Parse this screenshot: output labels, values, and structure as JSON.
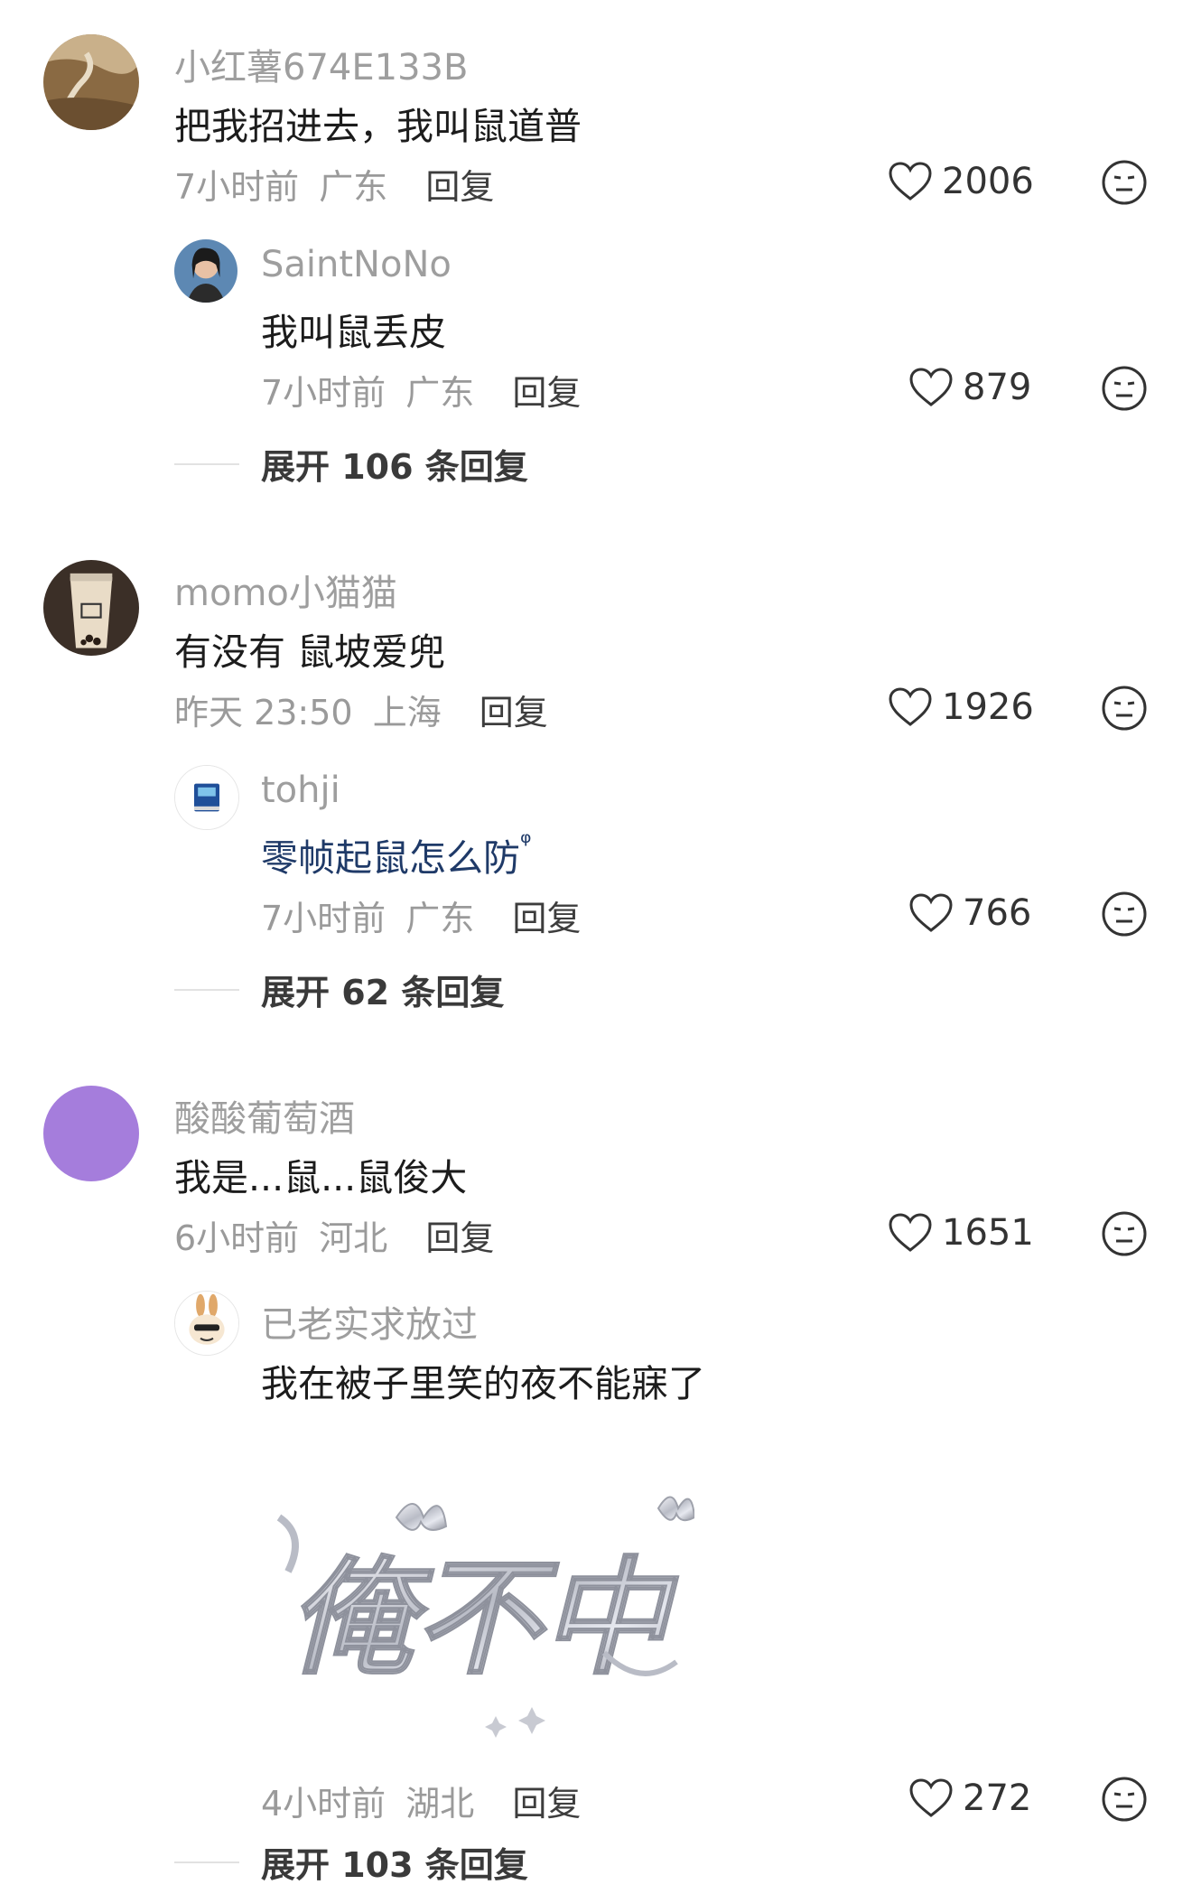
{
  "threads": [
    {
      "comment": {
        "username": "小红薯674E133B",
        "text": "把我招进去，我叫鼠道普",
        "time": "7小时前",
        "location": "广东",
        "reply_label": "回复",
        "likes": "2006",
        "avatar": "landscape-photo-avatar"
      },
      "reply": {
        "username": "SaintNoNo",
        "text": "我叫鼠丢皮",
        "time": "7小时前",
        "location": "广东",
        "reply_label": "回复",
        "likes": "879",
        "avatar": "girl-photo-avatar"
      },
      "expand_label": "展开 106 条回复"
    },
    {
      "comment": {
        "username": "momo小猫猫",
        "text": "有没有 鼠坡爱兜",
        "time": "昨天 23:50",
        "location": "上海",
        "reply_label": "回复",
        "likes": "1926",
        "avatar": "milk-tea-avatar"
      },
      "reply": {
        "username": "tohji",
        "text": "零帧起鼠怎么防",
        "search_glyph": "ᵠ",
        "time": "7小时前",
        "location": "广东",
        "reply_label": "回复",
        "likes": "766",
        "avatar": "blue-book-avatar"
      },
      "expand_label": "展开 62 条回复"
    },
    {
      "comment": {
        "username": "酸酸葡萄酒",
        "text": "我是...鼠...鼠俊大",
        "time": "6小时前",
        "location": "河北",
        "reply_label": "回复",
        "likes": "1651",
        "avatar": "purple-circle-avatar"
      },
      "reply": {
        "username": "已老实求放过",
        "text": "我在被子里笑的夜不能寐了",
        "sticker_text": "俺不中",
        "time": "4小时前",
        "location": "湖北",
        "reply_label": "回复",
        "likes": "272",
        "avatar": "cartoon-bunny-avatar"
      },
      "expand_label": "展开 103 条回复"
    }
  ],
  "colors": {
    "purple_avatar": "#a57ddc",
    "name_gray": "#9e9e9e",
    "link_blue": "#1f3a68"
  },
  "icons": {
    "like": "heart-outline-icon",
    "dislike": "neutral-face-icon"
  }
}
